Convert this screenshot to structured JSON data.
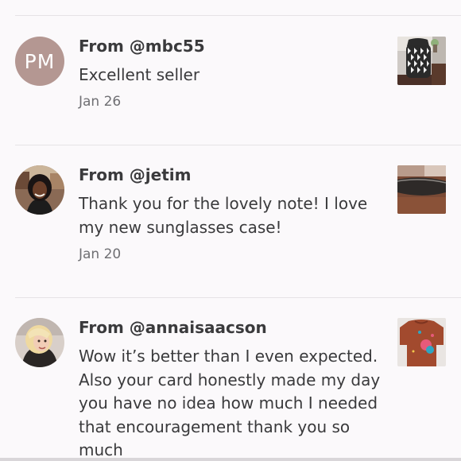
{
  "reviews": [
    {
      "avatar_initials": "PM",
      "from": "From @mbc55",
      "message": "Excellent seller",
      "date": "Jan 26"
    },
    {
      "from": "From @jetim",
      "message": "Thank you for the lovely note! I love my new sunglasses case!",
      "date": "Jan 20"
    },
    {
      "from": "From @annaisaacson",
      "message": "Wow it’s better than I even expected. Also your card honestly made my day you have no idea how much I needed that encouragement thank you so much"
    }
  ],
  "colors": {
    "avatar_initials_bg": "#b49792",
    "text": "#3a3a3c",
    "muted_text": "#6f6f73",
    "divider": "#e6e3e6",
    "background": "#fbf9fb"
  }
}
